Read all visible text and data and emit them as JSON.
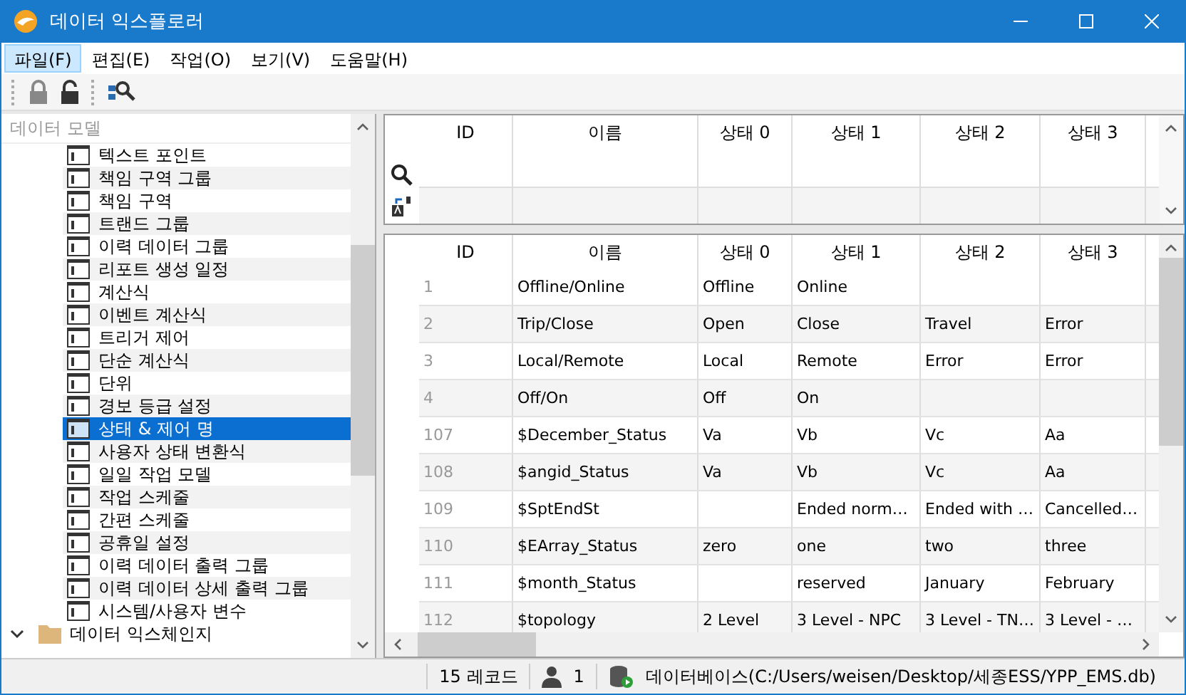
{
  "window": {
    "title": "데이터 익스플로러"
  },
  "menu": [
    {
      "label": "파일(F)",
      "selected": true
    },
    {
      "label": "편집(E)",
      "selected": false
    },
    {
      "label": "작업(O)",
      "selected": false
    },
    {
      "label": "보기(V)",
      "selected": false
    },
    {
      "label": "도움말(H)",
      "selected": false
    }
  ],
  "sidebar": {
    "header": "데이터 모델",
    "items": [
      {
        "kind": "table",
        "label": "텍스트 포인트",
        "selected": false
      },
      {
        "kind": "table",
        "label": "책임 구역 그룹",
        "selected": false
      },
      {
        "kind": "table",
        "label": "책임 구역",
        "selected": false
      },
      {
        "kind": "table",
        "label": "트랜드 그룹",
        "selected": false
      },
      {
        "kind": "table",
        "label": "이력 데이터 그룹",
        "selected": false
      },
      {
        "kind": "table",
        "label": "리포트 생성 일정",
        "selected": false
      },
      {
        "kind": "table",
        "label": "계산식",
        "selected": false
      },
      {
        "kind": "table",
        "label": "이벤트 계산식",
        "selected": false
      },
      {
        "kind": "table",
        "label": "트리거 제어",
        "selected": false
      },
      {
        "kind": "table",
        "label": "단순 계산식",
        "selected": false
      },
      {
        "kind": "table",
        "label": "단위",
        "selected": false
      },
      {
        "kind": "table",
        "label": "경보 등급 설정",
        "selected": false
      },
      {
        "kind": "table",
        "label": "상태 & 제어 명",
        "selected": true
      },
      {
        "kind": "table",
        "label": "사용자 상태 변환식",
        "selected": false
      },
      {
        "kind": "table",
        "label": "일일 작업 모델",
        "selected": false
      },
      {
        "kind": "table",
        "label": "작업 스케줄",
        "selected": false
      },
      {
        "kind": "table",
        "label": "간편 스케줄",
        "selected": false
      },
      {
        "kind": "table",
        "label": "공휴일 설정",
        "selected": false
      },
      {
        "kind": "table",
        "label": "이력 데이터 출력 그룹",
        "selected": false
      },
      {
        "kind": "table",
        "label": "이력 데이터 상세 출력 그룹",
        "selected": false
      },
      {
        "kind": "table",
        "label": "시스템/사용자 변수",
        "selected": false
      },
      {
        "kind": "folder",
        "label": "데이터 익스체인지",
        "expanded": true,
        "selected": false
      }
    ]
  },
  "filter_grid": {
    "columns": [
      "ID",
      "이름",
      "상태 0",
      "상태 1",
      "상태 2",
      "상태 3"
    ]
  },
  "table": {
    "columns": [
      "ID",
      "이름",
      "상태 0",
      "상태 1",
      "상태 2",
      "상태 3"
    ],
    "rows": [
      {
        "cells": [
          "1",
          "Offline/Online",
          "Offline",
          "Online",
          "",
          ""
        ]
      },
      {
        "cells": [
          "2",
          "Trip/Close",
          "Open",
          "Close",
          "Travel",
          "Error"
        ]
      },
      {
        "cells": [
          "3",
          "Local/Remote",
          "Local",
          "Remote",
          "Error",
          "Error"
        ]
      },
      {
        "cells": [
          "4",
          "Off/On",
          "Off",
          "On",
          "",
          ""
        ]
      },
      {
        "cells": [
          "107",
          "$December_Status",
          "Va",
          "Vb",
          "Vc",
          "Aa"
        ]
      },
      {
        "cells": [
          "108",
          "$angid_Status",
          "Va",
          "Vb",
          "Vc",
          "Aa"
        ]
      },
      {
        "cells": [
          "109",
          "$SptEndSt",
          "",
          "Ended norm…",
          "Ended with …",
          "Cancelled…"
        ]
      },
      {
        "cells": [
          "110",
          "$EArray_Status",
          "zero",
          "one",
          "two",
          "three"
        ]
      },
      {
        "cells": [
          "111",
          "$month_Status",
          "",
          "reserved",
          "January",
          "February"
        ]
      },
      {
        "cells": [
          "112",
          "$topology",
          "2 Level",
          "3 Level - NPC",
          "3 Level - TN…",
          "3 Level - …"
        ]
      }
    ]
  },
  "status_bar": {
    "records": "15 레코드",
    "users": "1",
    "database": "데이터베이스(C:/Users/weisen/Desktop/세종ESS/YPP_EMS.db)"
  }
}
